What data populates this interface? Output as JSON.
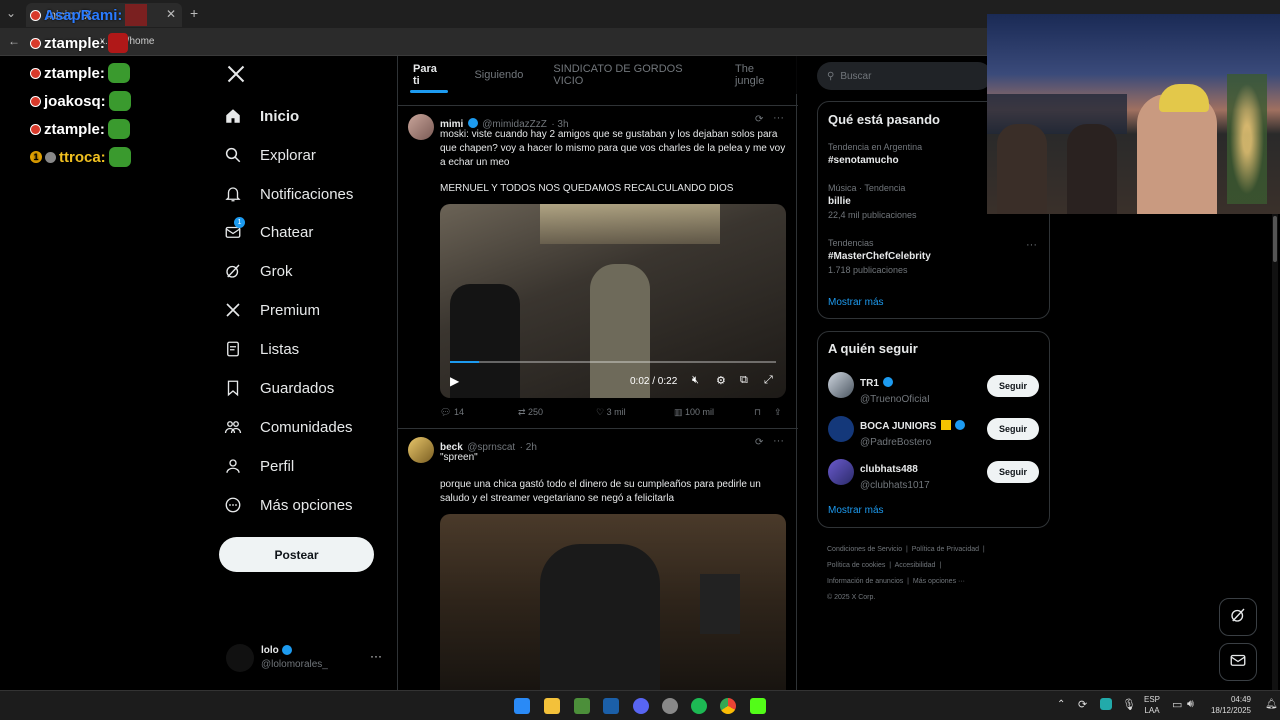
{
  "browser": {
    "tab_title": "Inicio / X",
    "address": "x.com/home"
  },
  "chat": [
    {
      "user": "AsapRami:"
    },
    {
      "user": "ztample:"
    },
    {
      "user": "ztample:"
    },
    {
      "user": "joakosq:"
    },
    {
      "user": "ztample:"
    },
    {
      "user": "ttroca:"
    }
  ],
  "nav": {
    "items": [
      {
        "label": "Inicio",
        "icon": "home-icon"
      },
      {
        "label": "Explorar",
        "icon": "search-icon"
      },
      {
        "label": "Notificaciones",
        "icon": "bell-icon"
      },
      {
        "label": "Chatear",
        "icon": "mail-icon"
      },
      {
        "label": "Grok",
        "icon": "grok-icon"
      },
      {
        "label": "Premium",
        "icon": "x-logo-icon"
      },
      {
        "label": "Listas",
        "icon": "list-icon"
      },
      {
        "label": "Guardados",
        "icon": "bookmark-icon"
      },
      {
        "label": "Comunidades",
        "icon": "people-icon"
      },
      {
        "label": "Perfil",
        "icon": "person-icon"
      },
      {
        "label": "Más opciones",
        "icon": "more-circle-icon"
      }
    ],
    "post_button": "Postear",
    "chatear_badge": "1",
    "account": {
      "name": "lolo",
      "handle": "@lolomorales_"
    }
  },
  "timeline": {
    "tabs": [
      "Para ti",
      "Siguiendo",
      "SINDICATO DE GORDOS VICIO",
      "The jungle"
    ],
    "posts": [
      {
        "name": "mimi",
        "handle": "@mimidazZzZ",
        "time": "· 3h",
        "text1": "moski: viste cuando hay 2 amigos que se gustaban y los dejaban solos para que chapen? voy a hacer lo mismo para que vos charles de la pelea y me voy a echar un meo",
        "text2": "MERNUEL Y TODOS NOS QUEDAMOS RECALCULANDO DIOS",
        "video_time": "0:02 / 0:22",
        "video_progress": 0.09,
        "replies": "14",
        "reposts": "250",
        "likes": "3 mil",
        "views": "100 mil"
      },
      {
        "name": "beck",
        "handle": "@sprnscat",
        "time": "· 2h",
        "text1": "\"spreen\"",
        "text2": "porque una chica gastó todo el dinero de su cumpleaños para pedirle un saludo y el streamer vegetariano se negó a felicitarla"
      }
    ]
  },
  "right": {
    "search_placeholder": "Buscar",
    "trends_title": "Qué está pasando",
    "trends": [
      {
        "context": "Tendencia en Argentina",
        "name": "#senotamucho",
        "count": ""
      },
      {
        "context": "Música · Tendencia",
        "name": "billie",
        "count": "22,4 mil publicaciones"
      },
      {
        "context": "Tendencias",
        "name": "#MasterChefCelebrity",
        "count": "1.718 publicaciones"
      }
    ],
    "show_more": "Mostrar más",
    "follow_title": "A quién seguir",
    "follow": [
      {
        "name": "TR1",
        "handle": "@TruenoOficiaI"
      },
      {
        "name": "BOCA JUNIORS",
        "handle": "@PadreBostero"
      },
      {
        "name": "clubhats488",
        "handle": "@clubhats1017"
      }
    ],
    "follow_button": "Seguir",
    "footer": [
      "Condiciones de Servicio",
      "Política de Privacidad",
      "Política de cookies",
      "Accesibilidad",
      "Información de anuncios",
      "Más opciones ···",
      "© 2025 X Corp."
    ]
  },
  "taskbar": {
    "lang": "ESP",
    "lang2": "LAA",
    "time": "04:49",
    "date": "18/12/2025"
  }
}
